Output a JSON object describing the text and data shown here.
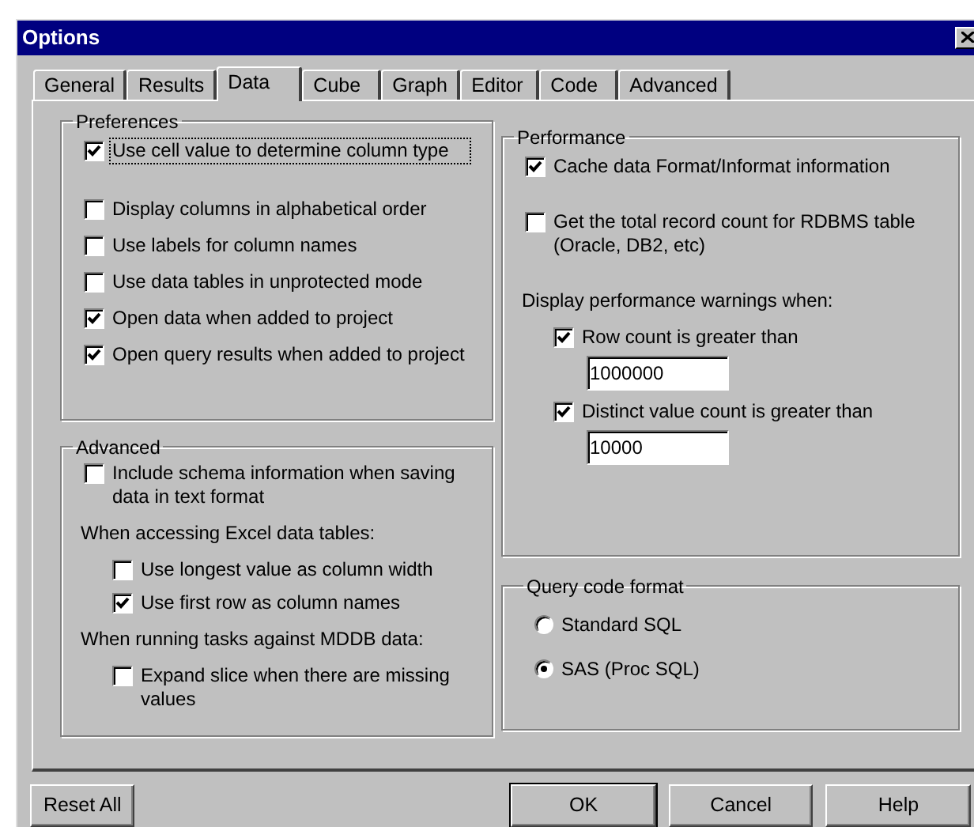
{
  "window": {
    "title": "Options"
  },
  "tabs": [
    {
      "label": "General",
      "selected": false
    },
    {
      "label": "Results",
      "selected": false
    },
    {
      "label": "Data",
      "selected": true
    },
    {
      "label": "Cube",
      "selected": false
    },
    {
      "label": "Graph",
      "selected": false
    },
    {
      "label": "Editor",
      "selected": false
    },
    {
      "label": "Code",
      "selected": false
    },
    {
      "label": "Advanced",
      "selected": false
    }
  ],
  "preferences": {
    "title": "Preferences",
    "options": [
      {
        "label": "Use cell value to determine column type",
        "checked": true,
        "focused": true
      },
      {
        "label": "Display columns in alphabetical order",
        "checked": false,
        "focused": false
      },
      {
        "label": "Use labels for column names",
        "checked": false,
        "focused": false
      },
      {
        "label": "Use data tables in unprotected mode",
        "checked": false,
        "focused": false
      },
      {
        "label": "Open data when added to project",
        "checked": true,
        "focused": false
      },
      {
        "label": "Open query results when added to project",
        "checked": true,
        "focused": false
      }
    ]
  },
  "advanced": {
    "title": "Advanced",
    "items": [
      {
        "kind": "checkbox",
        "label": "Include schema information when saving data in text format",
        "checked": false
      },
      {
        "kind": "heading",
        "label": "When accessing Excel data tables:",
        "children": [
          {
            "kind": "checkbox",
            "label": "Use longest value as column width",
            "checked": false
          },
          {
            "kind": "checkbox",
            "label": "Use first row as column names",
            "checked": true
          }
        ]
      },
      {
        "kind": "heading",
        "label": "When running tasks against MDDB data:",
        "children": [
          {
            "kind": "checkbox",
            "label": "Expand slice when there are missing values",
            "checked": false
          }
        ]
      }
    ]
  },
  "performance": {
    "title": "Performance",
    "items": [
      {
        "kind": "checkbox",
        "label": "Cache data Format/Informat information",
        "checked": true
      },
      {
        "kind": "checkbox",
        "label": "Get the total record count for RDBMS table (Oracle, DB2, etc)",
        "checked": false
      },
      {
        "kind": "heading",
        "label": "Display performance warnings when:",
        "children": [
          {
            "kind": "checkbox",
            "label": "Row count is greater than",
            "checked": true,
            "value": "1000000"
          },
          {
            "kind": "checkbox",
            "label": "Distinct value count is greater than",
            "checked": true,
            "value": "10000"
          }
        ]
      }
    ]
  },
  "query_code_format": {
    "title": "Query code format",
    "options": [
      {
        "label": "Standard SQL",
        "selected": false
      },
      {
        "label": "SAS (Proc SQL)",
        "selected": true
      }
    ]
  },
  "buttons": [
    {
      "label": "Reset All",
      "default": false
    },
    {
      "label": "OK",
      "default": true
    },
    {
      "label": "Cancel",
      "default": false
    },
    {
      "label": "Help",
      "default": false
    }
  ]
}
